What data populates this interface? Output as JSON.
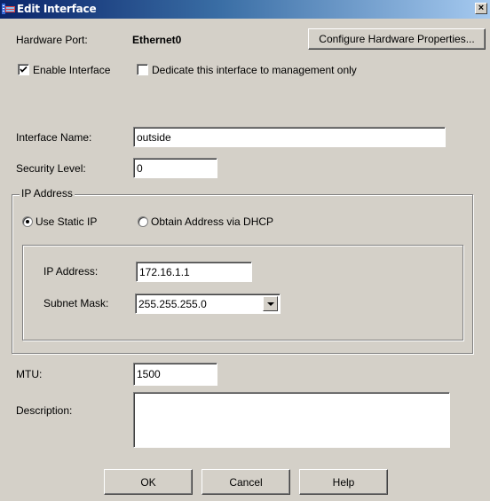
{
  "window": {
    "title": "Edit Interface",
    "icon": "network-interface-icon",
    "close_label": "×"
  },
  "hardware": {
    "label": "Hardware Port:",
    "value": "Ethernet0",
    "configure_button": "Configure Hardware Properties..."
  },
  "options": {
    "enable_interface": {
      "label": "Enable Interface",
      "checked": true
    },
    "management_only": {
      "label": "Dedicate this interface to management only",
      "checked": false
    }
  },
  "interface_name": {
    "label": "Interface Name:",
    "value": "outside"
  },
  "security_level": {
    "label": "Security Level:",
    "value": "0"
  },
  "ip_address_group": {
    "legend": "IP Address",
    "mode_static": {
      "label": "Use Static IP",
      "selected": true
    },
    "mode_dhcp": {
      "label": "Obtain Address via DHCP",
      "selected": false
    },
    "ip_address": {
      "label": "IP Address:",
      "value": "172.16.1.1"
    },
    "subnet_mask": {
      "label": "Subnet Mask:",
      "value": "255.255.255.0"
    }
  },
  "mtu": {
    "label": "MTU:",
    "value": "1500"
  },
  "description": {
    "label": "Description:",
    "value": ""
  },
  "buttons": {
    "ok": "OK",
    "cancel": "Cancel",
    "help": "Help"
  }
}
